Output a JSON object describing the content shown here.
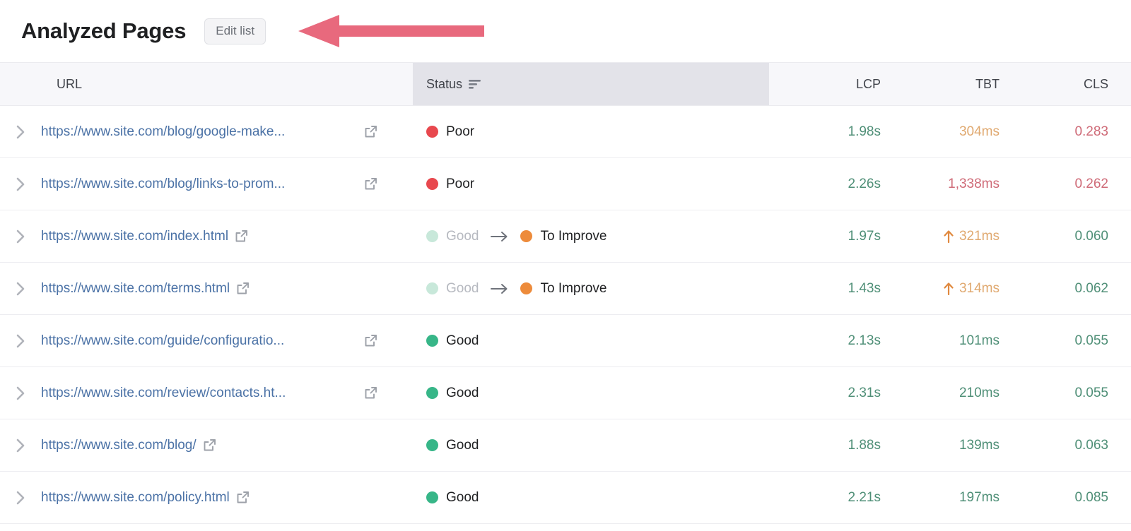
{
  "header": {
    "title": "Analyzed Pages",
    "edit_button_label": "Edit list",
    "annotation_arrow": {
      "icon": "left-arrow-annotation",
      "color": "#e8697d",
      "direction": "left"
    }
  },
  "table": {
    "columns": [
      {
        "key": "url",
        "label": "URL",
        "align": "left"
      },
      {
        "key": "status",
        "label": "Status",
        "align": "left",
        "icon": "sort-filter-icon",
        "highlighted": true
      },
      {
        "key": "lcp",
        "label": "LCP",
        "align": "right"
      },
      {
        "key": "tbt",
        "label": "TBT",
        "align": "right"
      },
      {
        "key": "cls",
        "label": "CLS",
        "align": "right"
      }
    ],
    "colors": {
      "good": "#37b688",
      "good_faded": "#c8e8da",
      "to_improve": "#ed8b3b",
      "poor": "#e8484e",
      "metric_good": "#4f8f77",
      "metric_warn": "#e0a970",
      "metric_poor": "#cf6b78",
      "link": "#4b72a6",
      "header_highlight": "#e3e3e9",
      "header_bg": "#f7f7fa"
    },
    "rows": [
      {
        "expand_icon": "chevron-right-icon",
        "url": "https://www.site.com/blog/google-make...",
        "url_truncated": true,
        "external_icon": "external-link-icon",
        "status": {
          "current": {
            "label": "Poor",
            "state": "poor"
          }
        },
        "lcp": {
          "value": "1.98s",
          "state": "good"
        },
        "tbt": {
          "value": "304ms",
          "state": "warn"
        },
        "cls": {
          "value": "0.283",
          "state": "poor"
        }
      },
      {
        "expand_icon": "chevron-right-icon",
        "url": "https://www.site.com/blog/links-to-prom...",
        "url_truncated": true,
        "external_icon": "external-link-icon",
        "status": {
          "current": {
            "label": "Poor",
            "state": "poor"
          }
        },
        "lcp": {
          "value": "2.26s",
          "state": "good"
        },
        "tbt": {
          "value": "1,338ms",
          "state": "poor"
        },
        "cls": {
          "value": "0.262",
          "state": "poor"
        }
      },
      {
        "expand_icon": "chevron-right-icon",
        "url": "https://www.site.com/index.html",
        "url_truncated": false,
        "external_icon": "external-link-icon",
        "status": {
          "previous": {
            "label": "Good",
            "state": "good-faded"
          },
          "transition_icon": "arrow-right-icon",
          "current": {
            "label": "To Improve",
            "state": "to-improve"
          }
        },
        "lcp": {
          "value": "1.97s",
          "state": "good"
        },
        "tbt": {
          "value": "321ms",
          "state": "warn",
          "trend": "up",
          "trend_icon": "arrow-up-icon"
        },
        "cls": {
          "value": "0.060",
          "state": "good"
        }
      },
      {
        "expand_icon": "chevron-right-icon",
        "url": "https://www.site.com/terms.html",
        "url_truncated": false,
        "external_icon": "external-link-icon",
        "status": {
          "previous": {
            "label": "Good",
            "state": "good-faded"
          },
          "transition_icon": "arrow-right-icon",
          "current": {
            "label": "To Improve",
            "state": "to-improve"
          }
        },
        "lcp": {
          "value": "1.43s",
          "state": "good"
        },
        "tbt": {
          "value": "314ms",
          "state": "warn",
          "trend": "up",
          "trend_icon": "arrow-up-icon"
        },
        "cls": {
          "value": "0.062",
          "state": "good"
        }
      },
      {
        "expand_icon": "chevron-right-icon",
        "url": "https://www.site.com/guide/configuratio...",
        "url_truncated": true,
        "external_icon": "external-link-icon",
        "status": {
          "current": {
            "label": "Good",
            "state": "good"
          }
        },
        "lcp": {
          "value": "2.13s",
          "state": "good"
        },
        "tbt": {
          "value": "101ms",
          "state": "good"
        },
        "cls": {
          "value": "0.055",
          "state": "good"
        }
      },
      {
        "expand_icon": "chevron-right-icon",
        "url": "https://www.site.com/review/contacts.ht...",
        "url_truncated": true,
        "external_icon": "external-link-icon",
        "status": {
          "current": {
            "label": "Good",
            "state": "good"
          }
        },
        "lcp": {
          "value": "2.31s",
          "state": "good"
        },
        "tbt": {
          "value": "210ms",
          "state": "good"
        },
        "cls": {
          "value": "0.055",
          "state": "good"
        }
      },
      {
        "expand_icon": "chevron-right-icon",
        "url": "https://www.site.com/blog/",
        "url_truncated": false,
        "external_icon": "external-link-icon",
        "status": {
          "current": {
            "label": "Good",
            "state": "good"
          }
        },
        "lcp": {
          "value": "1.88s",
          "state": "good"
        },
        "tbt": {
          "value": "139ms",
          "state": "good"
        },
        "cls": {
          "value": "0.063",
          "state": "good"
        }
      },
      {
        "expand_icon": "chevron-right-icon",
        "url": "https://www.site.com/policy.html",
        "url_truncated": false,
        "external_icon": "external-link-icon",
        "status": {
          "current": {
            "label": "Good",
            "state": "good"
          }
        },
        "lcp": {
          "value": "2.21s",
          "state": "good"
        },
        "tbt": {
          "value": "197ms",
          "state": "good"
        },
        "cls": {
          "value": "0.085",
          "state": "good"
        }
      }
    ]
  }
}
